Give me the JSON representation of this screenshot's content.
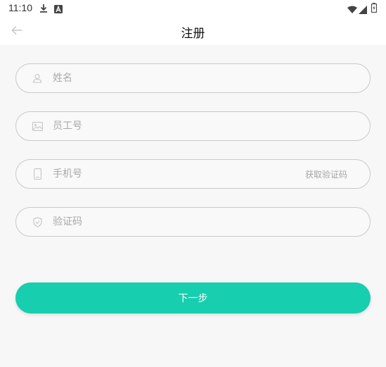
{
  "status_bar": {
    "time": "11:10",
    "icons": [
      "download-icon",
      "a-badge-icon",
      "wifi-icon",
      "signal-icon",
      "battery-icon"
    ]
  },
  "app_bar": {
    "title": "注册",
    "back_icon": "arrow-left-icon"
  },
  "form": {
    "name": {
      "placeholder": "姓名",
      "value": "",
      "icon": "person-icon"
    },
    "employee_id": {
      "placeholder": "员工号",
      "value": "",
      "icon": "image-card-icon"
    },
    "phone": {
      "placeholder": "手机号",
      "value": "",
      "icon": "phone-icon",
      "action_label": "获取验证码"
    },
    "code": {
      "placeholder": "验证码",
      "value": "",
      "icon": "shield-check-icon"
    }
  },
  "next_button": {
    "label": "下一步"
  },
  "colors": {
    "accent": "#17ceae",
    "background": "#f7f7f7",
    "field_border": "#c9c9c9",
    "placeholder": "#a9a9a9"
  }
}
